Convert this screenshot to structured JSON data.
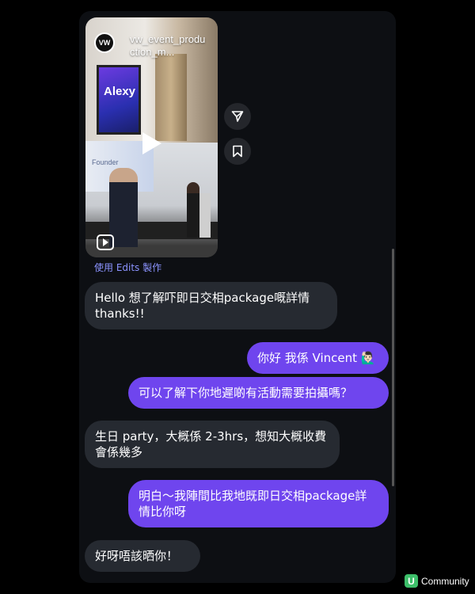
{
  "reel": {
    "username": "vw_event_production_m...",
    "avatar_text": "VW",
    "screen_title": "Alexy",
    "banner_text": "Founder"
  },
  "edits_label": "使用 Edits 製作",
  "messages": [
    {
      "direction": "incoming",
      "text": "Hello 想了解吓即日交相package嘅詳情thanks!!"
    },
    {
      "direction": "outgoing",
      "text": "你好 我係 Vincent 🙋🏻‍♂️"
    },
    {
      "direction": "outgoing",
      "text": "可以了解下你地遲啲有活動需要拍攝嗎？"
    },
    {
      "direction": "incoming",
      "text": "生日 party，大概係 2-3hrs，想知大概收費會係幾多"
    },
    {
      "direction": "outgoing",
      "text": "明白～我陣間比我地既即日交相package詳情比你呀"
    },
    {
      "direction": "incoming",
      "text": "好呀唔該晒你！"
    }
  ],
  "watermark": {
    "badge": "U",
    "text": "Community"
  },
  "colors": {
    "incoming_bubble": "#262a31",
    "outgoing_bubble": "#6f45ee",
    "link": "#8b93ff"
  }
}
